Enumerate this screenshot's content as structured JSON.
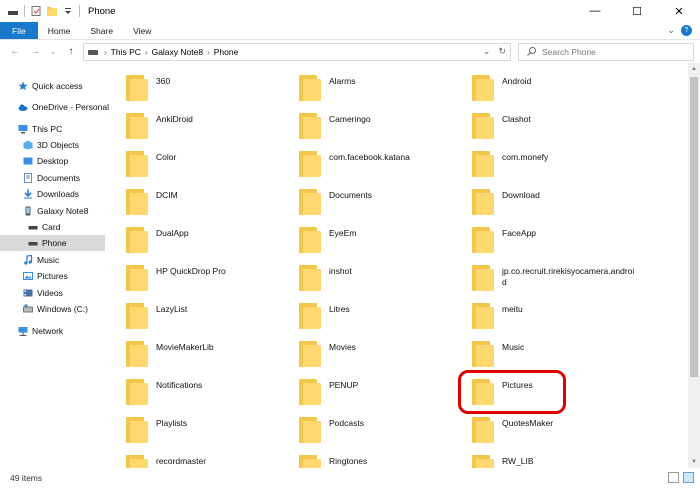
{
  "window": {
    "title": "Phone"
  },
  "ribbon": {
    "tabs": [
      "File",
      "Home",
      "Share",
      "View"
    ]
  },
  "address": {
    "crumbs": [
      "This PC",
      "Galaxy Note8",
      "Phone"
    ]
  },
  "search": {
    "placeholder": "Search Phone"
  },
  "nav": {
    "items": [
      {
        "label": "Quick access",
        "icon": "star-icon"
      },
      {
        "label": "OneDrive - Personal",
        "icon": "cloud-icon"
      },
      {
        "label": "This PC",
        "icon": "computer-icon"
      },
      {
        "label": "3D Objects",
        "icon": "cube-icon"
      },
      {
        "label": "Desktop",
        "icon": "desktop-icon"
      },
      {
        "label": "Documents",
        "icon": "document-icon"
      },
      {
        "label": "Downloads",
        "icon": "download-icon"
      },
      {
        "label": "Galaxy Note8",
        "icon": "phone-icon"
      },
      {
        "label": "Card",
        "icon": "drive-icon"
      },
      {
        "label": "Phone",
        "icon": "drive-icon"
      },
      {
        "label": "Music",
        "icon": "music-icon"
      },
      {
        "label": "Pictures",
        "icon": "pictures-icon"
      },
      {
        "label": "Videos",
        "icon": "video-icon"
      },
      {
        "label": "Windows (C:)",
        "icon": "hard-drive-icon"
      },
      {
        "label": "Network",
        "icon": "network-icon"
      }
    ]
  },
  "folders": [
    "360",
    "Alarms",
    "Android",
    "AnkiDroid",
    "Cameringo",
    "Clashot",
    "Color",
    "com.facebook.katana",
    "com.monefy",
    "DCIM",
    "Documents",
    "Download",
    "DualApp",
    "EyeEm",
    "FaceApp",
    "HP QuickDrop Pro",
    "inshot",
    "jp.co.recruit.rirekisyocamera.android",
    "LazyList",
    "Litres",
    "meitu",
    "MovieMakerLib",
    "Movies",
    "Music",
    "Notifications",
    "PENUP",
    "Pictures",
    "Playlists",
    "Podcasts",
    "QuotesMaker",
    "recordmaster",
    "Ringtones",
    "RW_LIB"
  ],
  "status": {
    "count": "49 items"
  },
  "colors": {
    "file_tab": "#1979ca",
    "highlight": "#e00000",
    "folder": "#ffd970"
  }
}
